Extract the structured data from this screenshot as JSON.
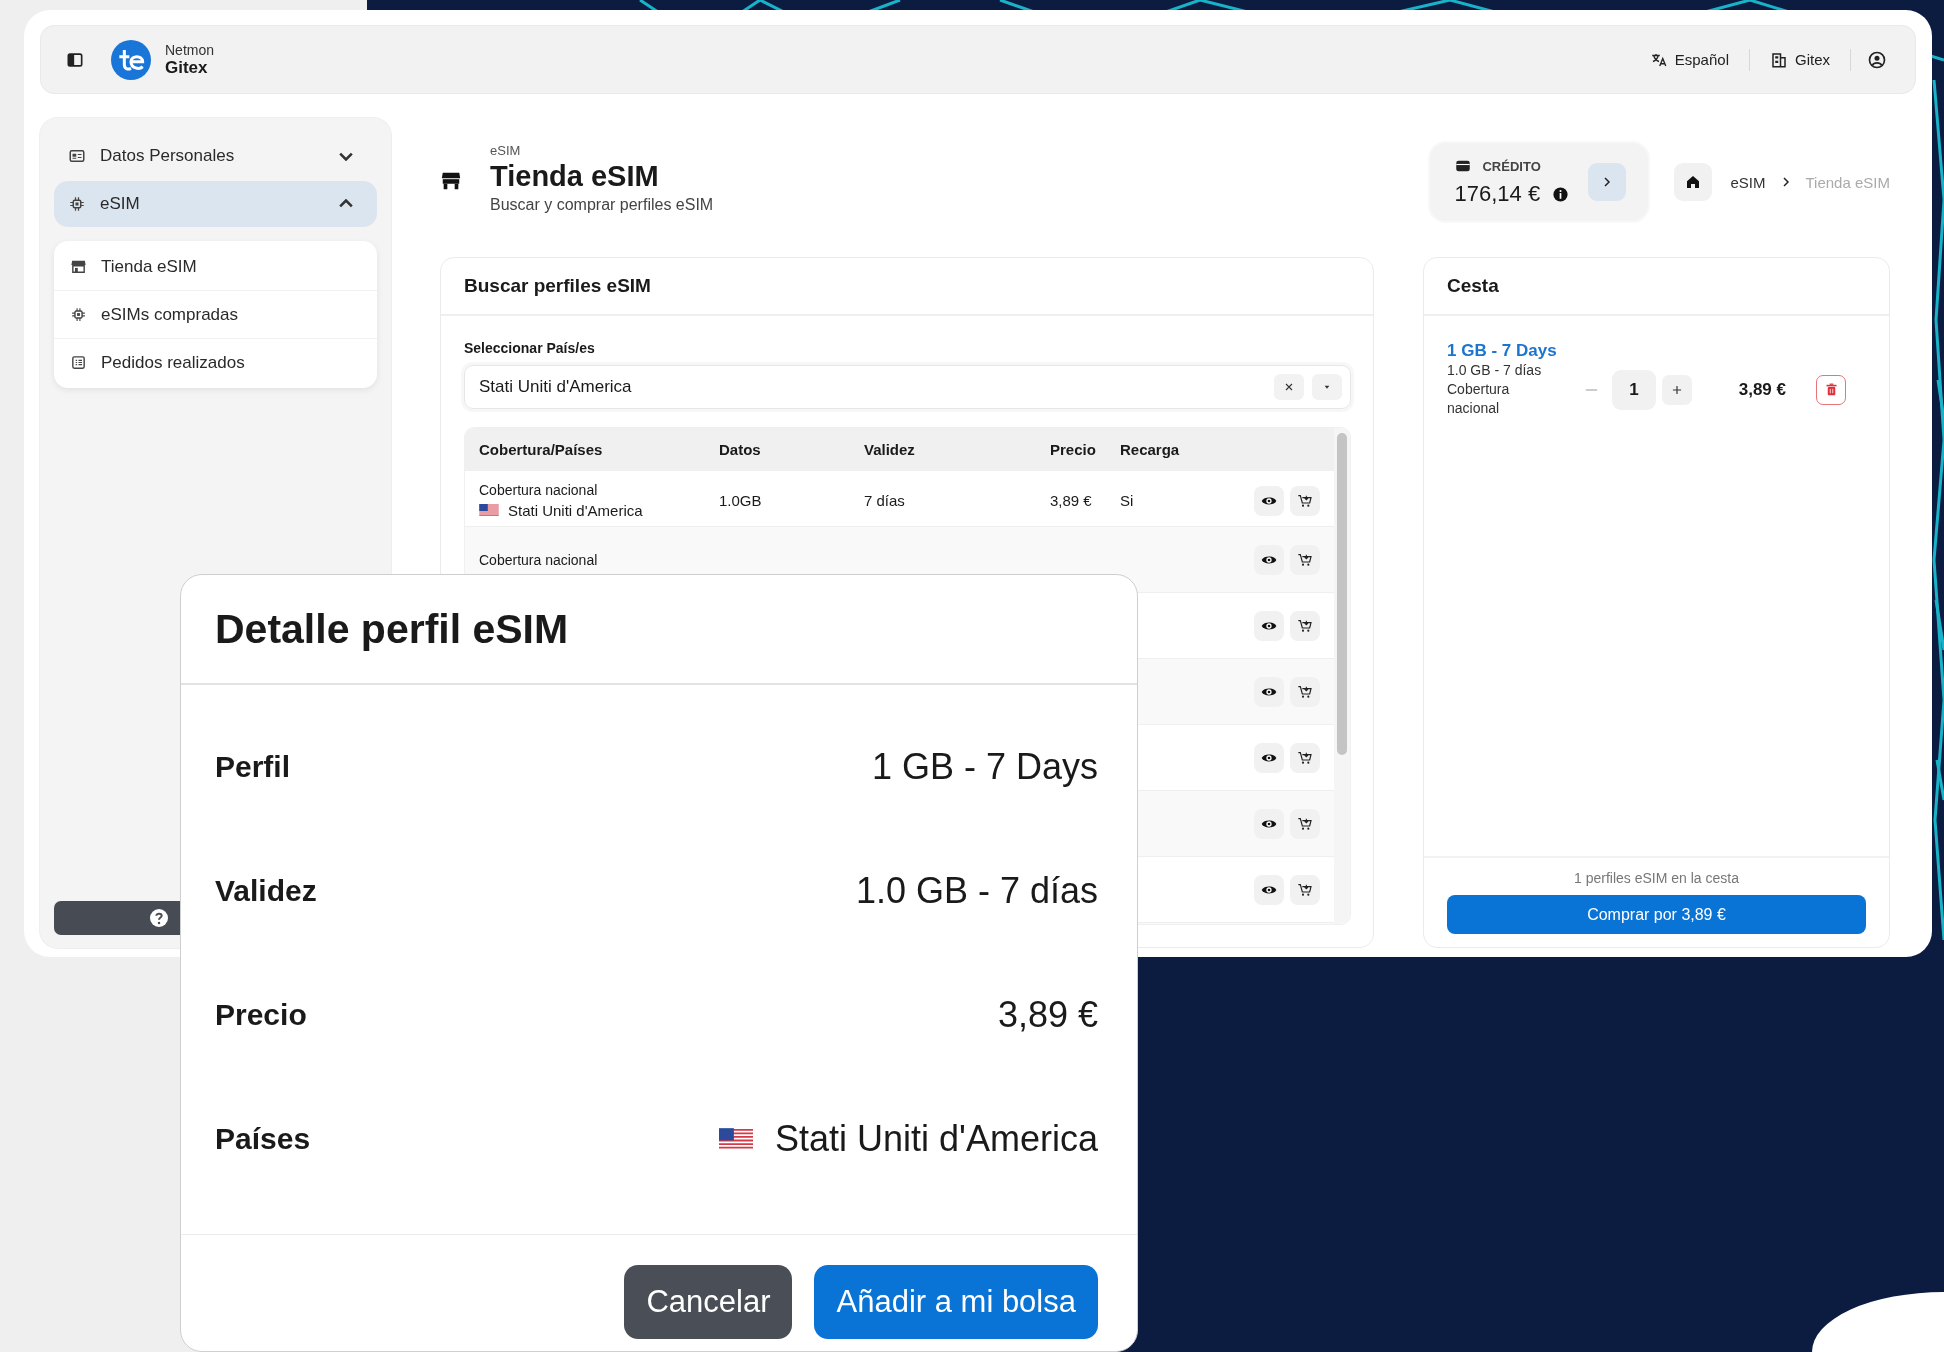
{
  "header": {
    "product": "Netmon",
    "organization": "Gitex",
    "language": "Español",
    "workspace": "Gitex"
  },
  "sidebar": {
    "items": [
      {
        "label": "Datos Personales",
        "kind": "card",
        "selected": false,
        "expanded": false
      },
      {
        "label": "eSIM",
        "kind": "chip",
        "selected": true,
        "expanded": true,
        "children": [
          {
            "label": "Tienda eSIM",
            "kind": "store"
          },
          {
            "label": "eSIMs compradas",
            "kind": "chip"
          },
          {
            "label": "Pedidos realizados",
            "kind": "list"
          }
        ]
      }
    ]
  },
  "page": {
    "section": "eSIM",
    "title": "Tienda eSIM",
    "subtitle": "Buscar y comprar perfiles eSIM"
  },
  "credit": {
    "label": "CRÉDITO",
    "amount": "176,14 €"
  },
  "breadcrumb": [
    {
      "label": "eSIM",
      "selected": false
    },
    {
      "label": "Tienda eSIM",
      "selected": true
    }
  ],
  "search": {
    "title": "Buscar perfiles eSIM",
    "field_label": "Seleccionar País/es",
    "value": "Stati Uniti d'America"
  },
  "table": {
    "columns": [
      "Cobertura/Países",
      "Datos",
      "Validez",
      "Precio",
      "Recarga"
    ],
    "rows": [
      {
        "coverage": "Cobertura nacional",
        "country": "Stati Uniti d'America",
        "data": "1.0GB",
        "validity": "7 días",
        "price": "3,89 €",
        "recharge": "Si"
      },
      {
        "coverage": "Cobertura nacional"
      },
      {},
      {},
      {},
      {},
      {}
    ]
  },
  "cart": {
    "title": "Cesta",
    "items": [
      {
        "name": "1 GB - 7 Days",
        "detail": "1.0 GB - 7 días",
        "coverage": "Cobertura nacional",
        "quantity": "1",
        "decrease_disabled": true,
        "price": "3,89 €"
      }
    ],
    "summary": "1 perfiles eSIM en la cesta",
    "buy_button": "Comprar por 3,89 €"
  },
  "modal": {
    "title": "Detalle perfil eSIM",
    "fields": [
      {
        "label": "Perfil",
        "value": "1 GB - 7 Days",
        "kind": "text"
      },
      {
        "label": "Validez",
        "value": "1.0 GB - 7 días",
        "kind": "text"
      },
      {
        "label": "Precio",
        "value": "3,89 €",
        "kind": "text"
      },
      {
        "label": "Países",
        "value": "Stati Uniti d'America",
        "kind": "country"
      }
    ],
    "buttons": [
      {
        "label": "Cancelar",
        "kind": "secondary"
      },
      {
        "label": "Añadir a mi bolsa",
        "kind": "primary"
      }
    ]
  }
}
